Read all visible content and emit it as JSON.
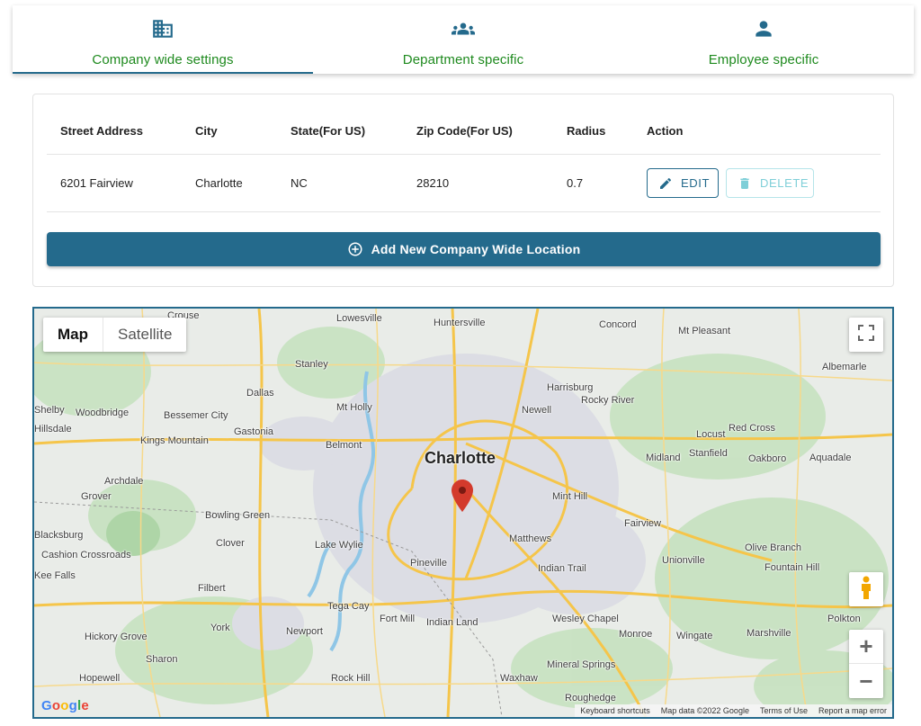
{
  "tabs": [
    {
      "label": "Company wide settings",
      "icon": "building-icon",
      "active": true
    },
    {
      "label": "Department specific",
      "icon": "group-icon",
      "active": false
    },
    {
      "label": "Employee specific",
      "icon": "person-icon",
      "active": false
    }
  ],
  "table": {
    "headers": [
      "Street Address",
      "City",
      "State(For US)",
      "Zip Code(For US)",
      "Radius",
      "Action"
    ],
    "rows": [
      {
        "street": "6201 Fairview",
        "city": "Charlotte",
        "state": "NC",
        "zip": "28210",
        "radius": "0.7"
      }
    ],
    "edit_label": "EDIT",
    "delete_label": "DELETE"
  },
  "add_button_label": "Add New Company Wide Location",
  "map": {
    "type_map": "Map",
    "type_satellite": "Satellite",
    "main_city": "Charlotte",
    "places": [
      "Crouse",
      "Lowesville",
      "Huntersville",
      "Concord",
      "Mt Pleasant",
      "Stanley",
      "Dallas",
      "Mt Holly",
      "Harrisburg",
      "Rocky River",
      "Albemarle",
      "Woodbridge",
      "Bessemer City",
      "Gastonia",
      "Belmont",
      "Newell",
      "Red Cross",
      "Locust",
      "Stanfield",
      "Oakboro",
      "Aquadale",
      "Kings Mountain",
      "Archdale",
      "Grover",
      "Midland",
      "Mint Hill",
      "Bowling Green",
      "Blacksburg",
      "Clover",
      "Lake Wylie",
      "Matthews",
      "Fairview",
      "Olive Branch",
      "Fountain Hill",
      "Cashion Crossroads",
      "Pineville",
      "Indian Trail",
      "Unionville",
      "Filbert",
      "Tega Cay",
      "Fort Mill",
      "Indian Land",
      "Wesley Chapel",
      "Polkton",
      "York",
      "Newport",
      "Monroe",
      "Wingate",
      "Marshville",
      "Hickory Grove",
      "Sharon",
      "Mineral Springs",
      "Hopewell",
      "Rock Hill",
      "Waxhaw",
      "Roughedge",
      "Hillsdale",
      "Shelby",
      "Kee Falls"
    ],
    "footer": [
      "Keyboard shortcuts",
      "Map data ©2022 Google",
      "Terms of Use",
      "Report a map error"
    ],
    "logo": "Google",
    "zoom_in": "+",
    "zoom_out": "−",
    "marker": "map-pin-icon"
  },
  "colors": {
    "accent": "#246a8c",
    "tab_text": "#1e8a1e",
    "delete": "#7fcfd8",
    "marker": "#d33a2c"
  }
}
